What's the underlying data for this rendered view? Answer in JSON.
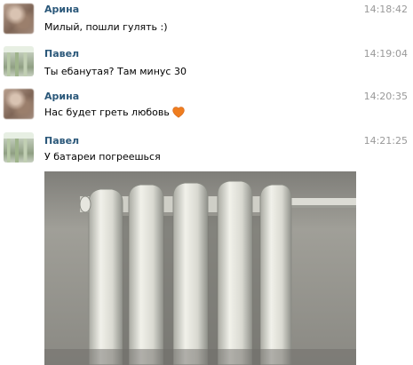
{
  "messages": [
    {
      "author": "Арина",
      "time": "14:18:42",
      "text": "Милый, пошли гулять :)",
      "avatar": "arina-avatar"
    },
    {
      "author": "Павел",
      "time": "14:19:04",
      "text": "Ты ебанутая? Там минус 30",
      "avatar": "pavel-avatar"
    },
    {
      "author": "Арина",
      "time": "14:20:35",
      "text": "Нас будет греть любовь",
      "emoji": "heart-icon",
      "avatar": "arina-avatar"
    },
    {
      "author": "Павел",
      "time": "14:21:25",
      "text": "У батареи погреешься",
      "attachment": "radiator-photo",
      "avatar": "pavel-avatar"
    }
  ],
  "colors": {
    "author_name": "#2b587a",
    "timestamp": "#999999",
    "heart": "#ef7d1f"
  }
}
